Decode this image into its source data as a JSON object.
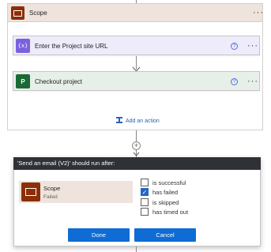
{
  "scope": {
    "title": "Scope",
    "more": "···",
    "actions": [
      {
        "label": "Enter the Project site URL",
        "icon": "variable-icon",
        "glyph": "{x}"
      },
      {
        "label": "Checkout project",
        "icon": "project-icon",
        "glyph": "P"
      }
    ],
    "help_glyph": "?",
    "add_action_label": "Add an action"
  },
  "run_after": {
    "header": "'Send an email (V2)' should run after:",
    "tile_title": "Scope",
    "tile_status": "Failed",
    "options": [
      {
        "label": "is successful",
        "checked": false
      },
      {
        "label": "has failed",
        "checked": true
      },
      {
        "label": "is skipped",
        "checked": false
      },
      {
        "label": "has timed out",
        "checked": false
      }
    ],
    "done_label": "Done",
    "cancel_label": "Cancel"
  },
  "colors": {
    "scope_brown": "#8c2e07",
    "accent_blue": "#0f6cd4",
    "variable_purple": "#7b61e0",
    "project_green": "#1b6a35"
  }
}
